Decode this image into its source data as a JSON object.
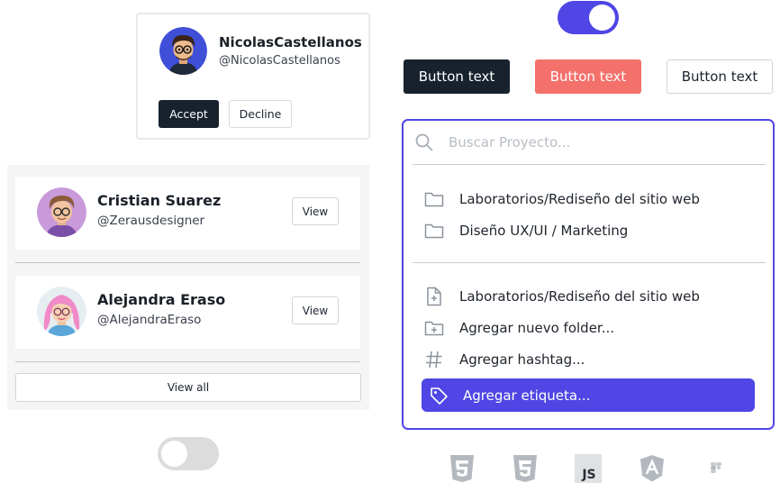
{
  "invite": {
    "name": "NicolasCastellanos",
    "handle": "@NicolasCastellanos",
    "accept_label": "Accept",
    "decline_label": "Decline"
  },
  "people": [
    {
      "name": "Cristian Suarez",
      "handle": "@Zerausdesigner",
      "action_label": "View"
    },
    {
      "name": "Alejandra Eraso",
      "handle": "@AlejandraEraso",
      "action_label": "View"
    }
  ],
  "view_all_label": "View all",
  "toggles": {
    "top": {
      "on": true
    },
    "bottom": {
      "on": false
    }
  },
  "buttons": {
    "dark": "Button text",
    "coral": "Button text",
    "outline": "Button text"
  },
  "palette": {
    "search_placeholder": "Buscar Proyecto...",
    "recent": [
      {
        "icon": "folder-icon",
        "label": "Laboratorios/Rediseño del sitio web"
      },
      {
        "icon": "folder-icon",
        "label": "Diseño UX/UI / Marketing"
      }
    ],
    "actions": [
      {
        "icon": "file-plus-icon",
        "label": "Laboratorios/Rediseño del sitio web"
      },
      {
        "icon": "folder-plus-icon",
        "label": "Agregar nuevo folder..."
      },
      {
        "icon": "hashtag-icon",
        "label": "Agregar  hashtag..."
      },
      {
        "icon": "tag-icon",
        "label": "Agregar etiqueta...",
        "highlighted": true
      }
    ]
  },
  "tech_logos": [
    "html5-icon",
    "css3-icon",
    "javascript-icon",
    "angular-icon",
    "figma-icon"
  ],
  "colors": {
    "accent": "#4f46e5",
    "dark": "#17222d",
    "coral": "#f4706b",
    "toggle_off": "#dcdcdc"
  }
}
